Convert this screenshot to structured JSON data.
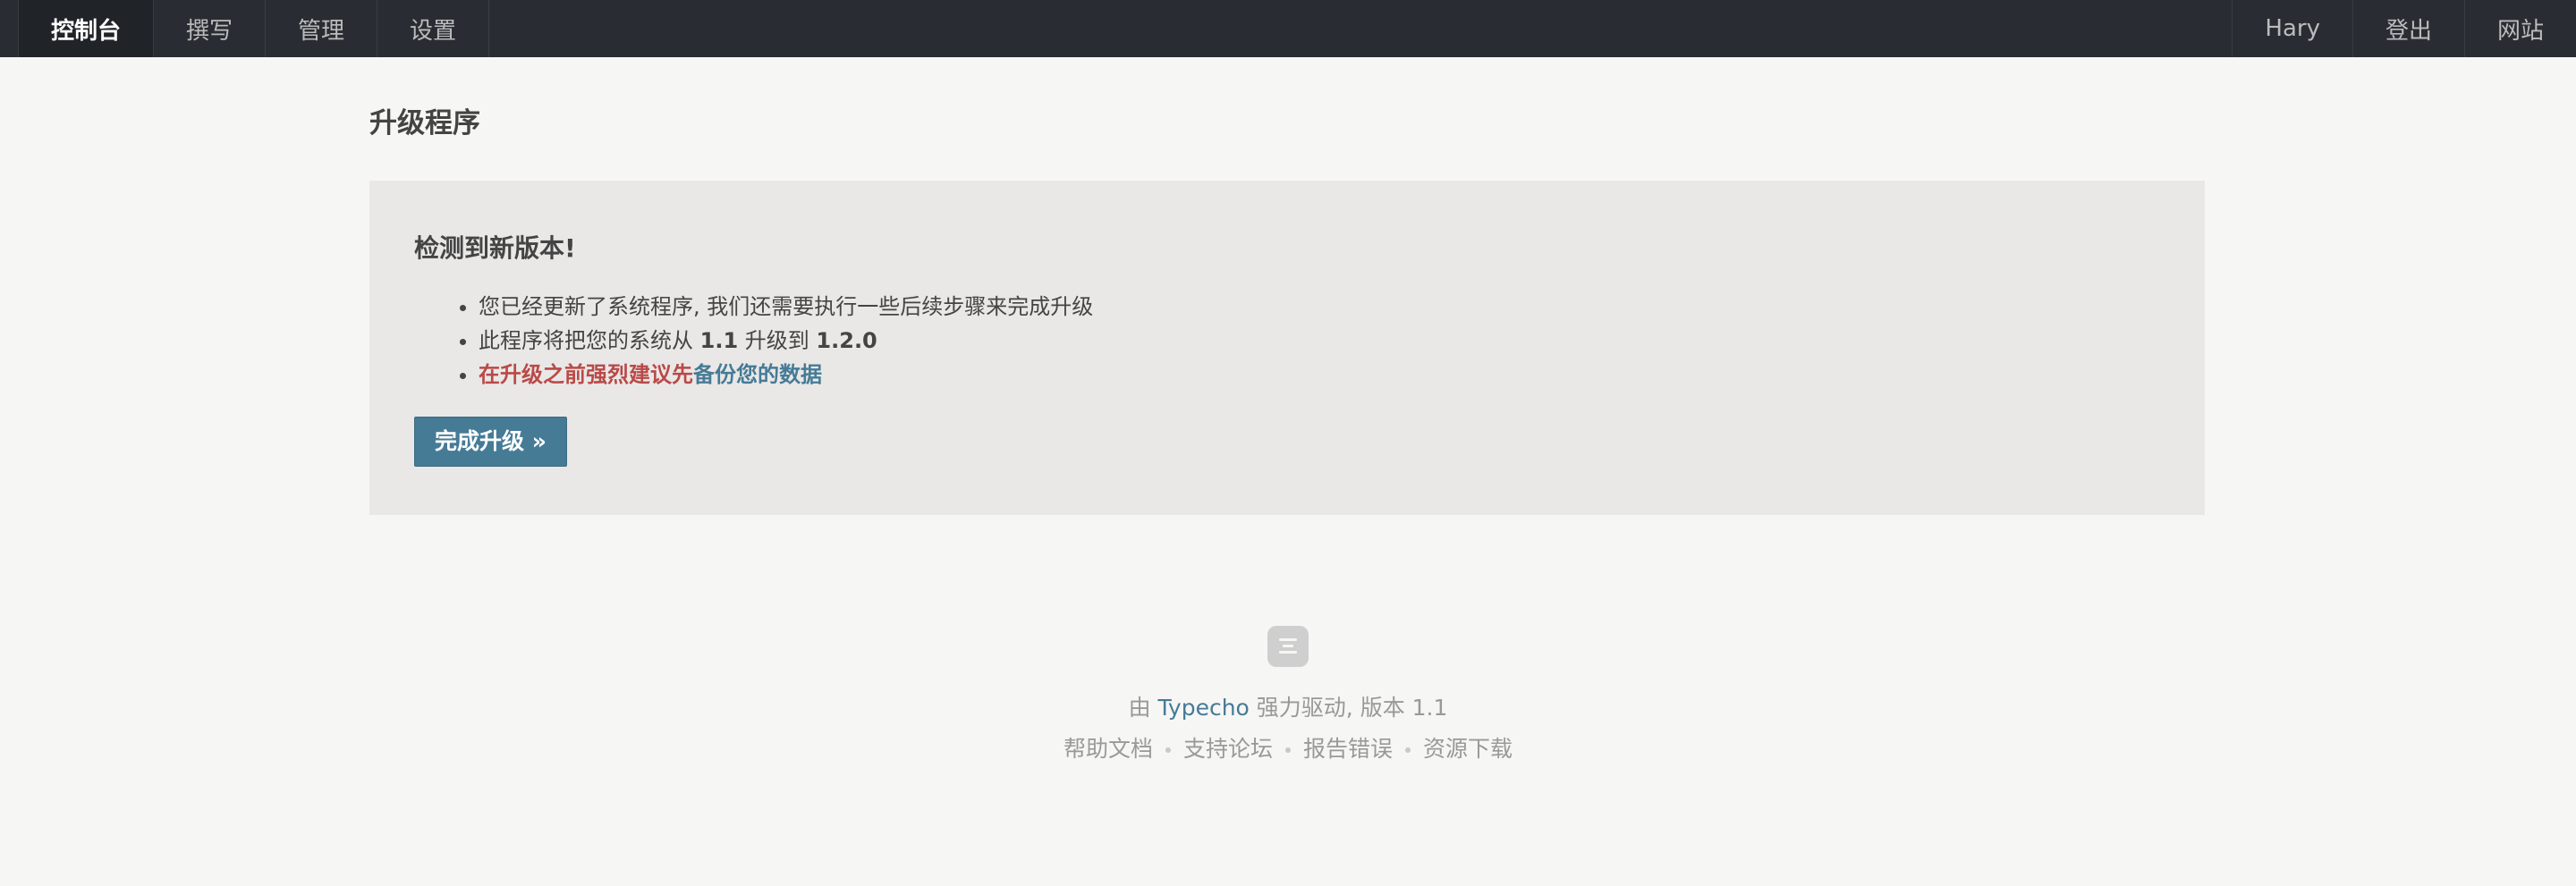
{
  "nav": {
    "left": [
      {
        "label": "控制台"
      },
      {
        "label": "撰写"
      },
      {
        "label": "管理"
      },
      {
        "label": "设置"
      }
    ],
    "right": [
      {
        "label": "Hary"
      },
      {
        "label": "登出"
      },
      {
        "label": "网站"
      }
    ]
  },
  "page": {
    "title": "升级程序"
  },
  "notice": {
    "heading": "检测到新版本!",
    "item1": "您已经更新了系统程序, 我们还需要执行一些后续步骤来完成升级",
    "item2_prefix": "此程序将把您的系统从 ",
    "from_version": "1.1",
    "item2_middle": " 升级到 ",
    "to_version": "1.2.0",
    "warning": "在升级之前强烈建议先",
    "backup_link": "备份您的数据",
    "button": "完成升级 »"
  },
  "footer": {
    "prefix": "由 ",
    "brand": "Typecho",
    "suffix": " 强力驱动, 版本 1.1",
    "links": [
      "帮助文档",
      "支持论坛",
      "报告错误",
      "资源下载"
    ],
    "icon": "typecho-logo-icon"
  },
  "colors": {
    "nav_bg": "#292d33",
    "accent": "#467b96",
    "warning": "#b94a48",
    "panel_bg": "#e9e8e7",
    "page_bg": "#f6f6f5"
  }
}
